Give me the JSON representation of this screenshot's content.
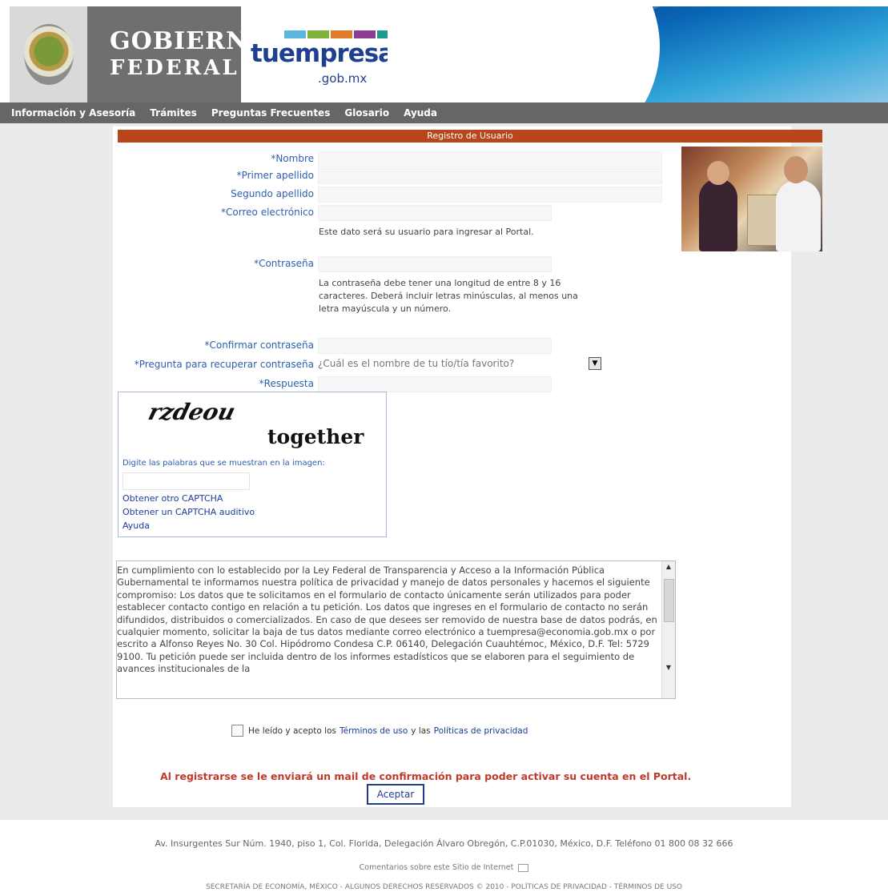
{
  "header": {
    "gob_line1": "GOBIERNO",
    "gob_line2": "FEDERAL",
    "tue_word": "tuempresa",
    "tue_domain": ".gob.mx",
    "bar_colors": [
      "#5bb5dd",
      "#7fb33a",
      "#e07b2a",
      "#8e3b94",
      "#1f9a8e"
    ]
  },
  "nav": {
    "items": [
      "Información y Asesoría",
      "Trámites",
      "Preguntas Frecuentes",
      "Glosario",
      "Ayuda"
    ]
  },
  "form": {
    "title": "Registro de Usuario",
    "nombre_label": "*Nombre",
    "primer_apellido_label": "*Primer apellido",
    "segundo_apellido_label": "Segundo apellido",
    "correo_label": "*Correo electrónico",
    "correo_note": "Este dato será su usuario para ingresar al Portal.",
    "contrasena_label": "*Contraseña",
    "contrasena_note": "La contraseña debe tener una longitud de entre 8 y 16 caracteres. Deberá incluir letras minúsculas, al menos una letra mayúscula y un número.",
    "confirmar_label": "*Confirmar contraseña",
    "pregunta_label": "*Pregunta para recuperar contraseña",
    "pregunta_value": "¿Cuál es el nombre de tu tío/tía favorito?",
    "respuesta_label": "*Respuesta"
  },
  "captcha": {
    "word1": "rzdeou",
    "word2": "together",
    "instruction": "Digite las palabras que se muestran en la imagen:",
    "link_other": "Obtener otro CAPTCHA",
    "link_audio": "Obtener un CAPTCHA auditivo",
    "link_help": "Ayuda"
  },
  "terms": {
    "text": "En cumplimiento con lo establecido por la Ley Federal de Transparencia y Acceso a la Información Pública Gubernamental te informamos nuestra política de privacidad y manejo de datos personales y hacemos el siguiente compromiso: Los datos que te solicitamos en el formulario de contacto únicamente serán utilizados para poder establecer contacto contigo en relación a tu petición. Los datos que ingreses en el formulario de contacto no serán difundidos, distribuidos o comercializados. En caso de que desees ser removido de nuestra base de datos podrás, en cualquier momento, solicitar la baja de tus datos mediante correo electrónico a tuempresa@economia.gob.mx o por escrito a Alfonso Reyes No. 30 Col. Hipódromo Condesa C.P. 06140, Delegación Cuauhtémoc, México, D.F. Tel: 5729 9100. Tu petición puede ser incluida dentro de los informes estadísticos que se elaboren para el seguimiento de avances institucionales de la"
  },
  "acceptance": {
    "prefix": "He leído y acepto los",
    "terms_link": "Términos de uso",
    "middle": "y las",
    "privacy_link": "Políticas de privacidad"
  },
  "confirm_message": "Al registrarse se le enviará un mail de confirmación para poder activar su cuenta en el Portal.",
  "accept_button": "Aceptar",
  "footer": {
    "address": "Av. Insurgentes Sur Núm. 1940, piso 1, Col. Florida, Delegación Álvaro Obregón, C.P.01030, México, D.F. Teléfono 01 800 08 32 666",
    "comments": "Comentarios sobre este Sitio de Internet",
    "copyright": "SECRETARÍA DE ECONOMÍA, MÉXICO - ALGUNOS DERECHOS RESERVADOS © 2010 - POLÍTICAS DE PRIVACIDAD - TÉRMINOS DE USO"
  }
}
